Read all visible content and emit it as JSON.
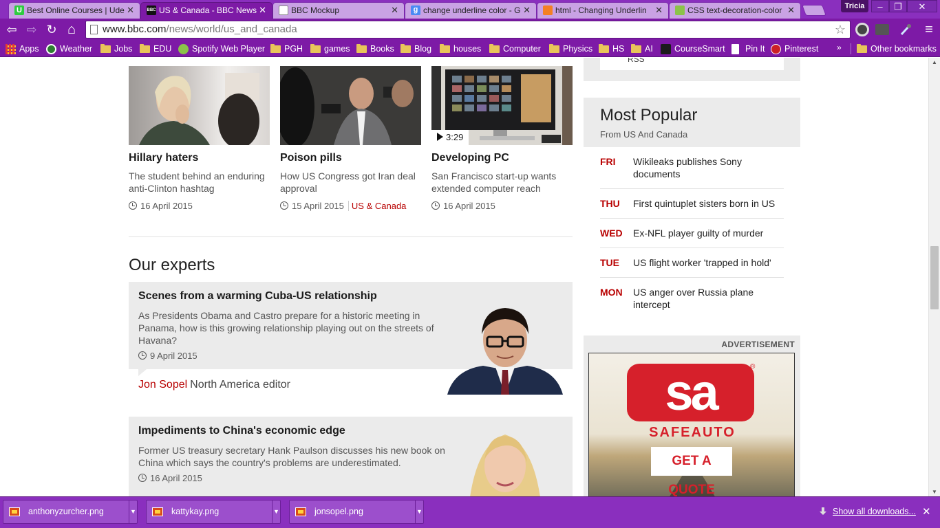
{
  "browser": {
    "tabs": [
      {
        "label": "Best Online Courses | Ude",
        "favicon_color": "#2ecc40",
        "favicon_letter": "U",
        "active": false
      },
      {
        "label": "US & Canada - BBC News",
        "favicon_color": "#111111",
        "favicon_letter": "BBC",
        "active": true
      },
      {
        "label": "BBC Mockup",
        "favicon_color": "#ffffff",
        "favicon_letter": "",
        "active": false
      },
      {
        "label": "change underline color - G",
        "favicon_color": "#4a8af4",
        "favicon_letter": "g",
        "active": false
      },
      {
        "label": "html - Changing Underlin",
        "favicon_color": "#f48024",
        "favicon_letter": "",
        "active": false
      },
      {
        "label": "CSS text-decoration-color",
        "favicon_color": "#8bc34a",
        "favicon_letter": "",
        "active": false
      }
    ],
    "profile": "Tricia",
    "window_buttons": {
      "minimize": "‒",
      "maximize": "❐",
      "close": "✕"
    },
    "url_host": "www.bbc.com",
    "url_path": "/news/world/us_and_canada",
    "nav_glyphs": {
      "back": "⇦",
      "forward": "⇨",
      "reload": "↻",
      "home": "⌂",
      "star": "☆",
      "menu": "≡"
    },
    "bookmarks": [
      {
        "label": "Apps",
        "icon": "apps-grid-icon"
      },
      {
        "label": "Weather",
        "icon": "weather-icon"
      },
      {
        "label": "Jobs",
        "icon": "folder-icon"
      },
      {
        "label": "EDU",
        "icon": "folder-icon"
      },
      {
        "label": "Spotify Web Player",
        "icon": "spotify-icon"
      },
      {
        "label": "PGH",
        "icon": "folder-icon"
      },
      {
        "label": "games",
        "icon": "folder-icon"
      },
      {
        "label": "Books",
        "icon": "folder-icon"
      },
      {
        "label": "Blog",
        "icon": "folder-icon"
      },
      {
        "label": "houses",
        "icon": "folder-icon"
      },
      {
        "label": "Computer",
        "icon": "folder-icon"
      },
      {
        "label": "Physics",
        "icon": "folder-icon"
      },
      {
        "label": "HS",
        "icon": "folder-icon"
      },
      {
        "label": "AI",
        "icon": "folder-icon"
      },
      {
        "label": "CourseSmart",
        "icon": "coursesmart-icon"
      },
      {
        "label": "Pin It",
        "icon": "pin-icon"
      },
      {
        "label": "Pinterest",
        "icon": "pinterest-icon"
      }
    ],
    "bookmarks_more": "»",
    "other_bookmarks": "Other bookmarks"
  },
  "page": {
    "rss_label": "RSS",
    "cards": [
      {
        "headline": "Hillary haters",
        "summary": "The student behind an enduring anti-Clinton hashtag",
        "date": "16 April 2015",
        "tag": "",
        "video_duration": ""
      },
      {
        "headline": "Poison pills",
        "summary": "How US Congress got Iran deal approval",
        "date": "15 April 2015",
        "tag": "US & Canada",
        "video_duration": ""
      },
      {
        "headline": "Developing PC",
        "summary": "San Francisco start-up wants extended computer reach",
        "date": "16 April 2015",
        "tag": "",
        "video_duration": "3:29"
      }
    ],
    "experts_title": "Our experts",
    "experts": [
      {
        "title": "Scenes from a warming Cuba-US relationship",
        "desc": "As Presidents Obama and Castro prepare for a historic meeting in Panama, how is this growing relationship playing out on the streets of Havana?",
        "date": "9 April 2015",
        "author": "Jon Sopel",
        "role": "North America editor"
      },
      {
        "title": "Impediments to China's economic edge",
        "desc": "Former US treasury secretary Hank Paulson discusses his new book on China which says the country's problems are underestimated.",
        "date": "16 April 2015",
        "author": "",
        "role": ""
      }
    ],
    "most_popular": {
      "title": "Most Popular",
      "subtitle": "From US And Canada",
      "items": [
        {
          "day": "FRI",
          "text": "Wikileaks publishes Sony documents"
        },
        {
          "day": "THU",
          "text": "First quintuplet sisters born in US"
        },
        {
          "day": "WED",
          "text": "Ex-NFL player guilty of murder"
        },
        {
          "day": "TUE",
          "text": "US flight worker 'trapped in hold'"
        },
        {
          "day": "MON",
          "text": "US anger over Russia plane intercept"
        }
      ]
    },
    "advertisement": {
      "label": "ADVERTISEMENT",
      "logo_text": "sa",
      "brand": "SAFEAUTO",
      "registered": "®",
      "cta": "GET A QUOTE"
    }
  },
  "downloads": {
    "items": [
      {
        "filename": "anthonyzurcher.png"
      },
      {
        "filename": "kattykay.png"
      },
      {
        "filename": "jonsopel.png"
      }
    ],
    "show_all": "Show all downloads...",
    "close": "✕"
  },
  "colors": {
    "bbc_red": "#b80000",
    "chrome_purple": "#7d1aa6",
    "sidebar_grey": "#ebebeb",
    "safeauto_red": "#d6202b"
  }
}
